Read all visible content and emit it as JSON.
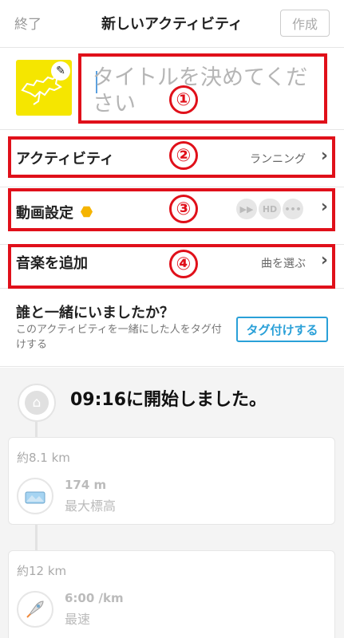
{
  "header": {
    "end_label": "終了",
    "title": "新しいアクティビティ",
    "create_label": "作成"
  },
  "title_input": {
    "placeholder": "タイトルを決めてください",
    "annotation": "①"
  },
  "rows": [
    {
      "label": "アクティビティ",
      "value": "ランニング",
      "annotation": "②"
    },
    {
      "label": "動画設定",
      "value": "",
      "annotation": "③",
      "pills": [
        "▶▶",
        "HD",
        "•••"
      ]
    },
    {
      "label": "音楽を追加",
      "value": "曲を選ぶ",
      "annotation": "④"
    }
  ],
  "tag": {
    "title": "誰と一緒にいましたか？",
    "description": "このアクティビティを一緒にした人をタグ付けする",
    "button_label": "タグ付けする"
  },
  "timeline": {
    "start_time": "09:16",
    "start_suffix": "に開始しました。",
    "cards": [
      {
        "distance": "約8.1 km",
        "stat_value": "174 m",
        "stat_label": "最大標高",
        "icon": "mountain-icon"
      },
      {
        "distance": "約12 km",
        "stat_value": "6:00 /km",
        "stat_label": "最速",
        "icon": "rocket-icon"
      }
    ]
  },
  "colors": {
    "annotation_red": "#e0101a",
    "accent_blue": "#2aa0d8",
    "map_yellow": "#f5e600",
    "premium_gold": "#f5b400"
  }
}
